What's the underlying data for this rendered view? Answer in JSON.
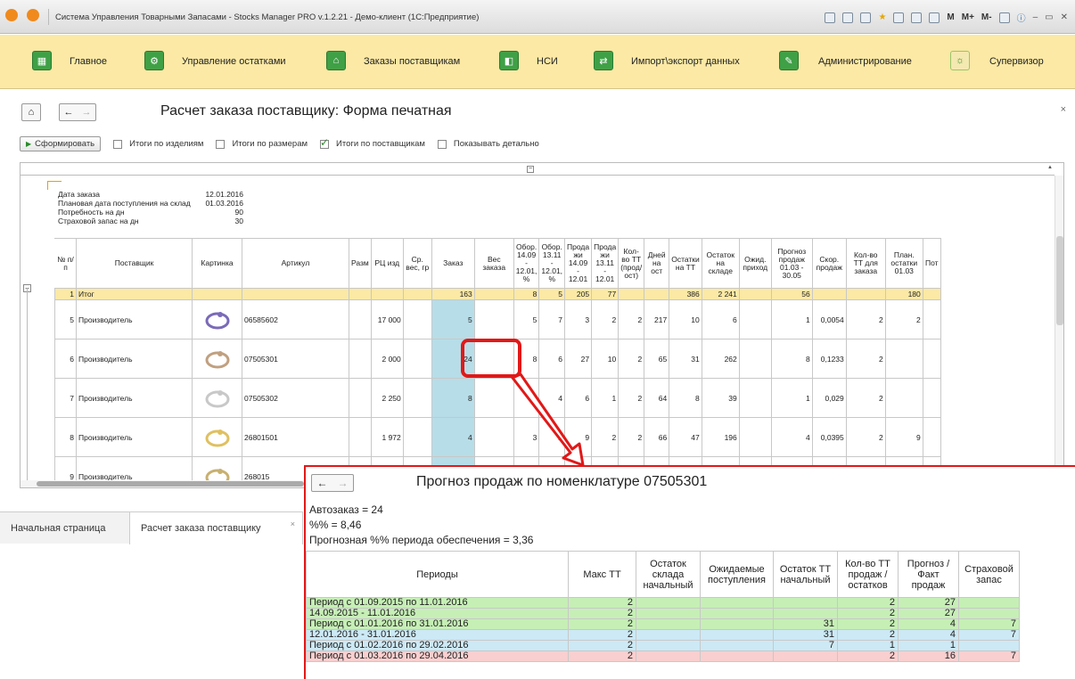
{
  "window": {
    "title": "Система Управления Товарными Запасами - Stocks Manager PRO v.1.2.21 - Демо-клиент (1С:Предприятие)",
    "tools": [
      "M",
      "M+",
      "M-"
    ]
  },
  "nav": {
    "items": [
      {
        "label": "Главное"
      },
      {
        "label": "Управление остатками"
      },
      {
        "label": "Заказы поставщикам"
      },
      {
        "label": "НСИ"
      },
      {
        "label": "Импорт\\экспорт данных"
      },
      {
        "label": "Администрирование"
      },
      {
        "label": "Супервизор"
      }
    ]
  },
  "page": {
    "title": "Расчет заказа поставщику: Форма печатная",
    "close": "×"
  },
  "toolbar": {
    "form_button": "Сформировать",
    "checks": [
      {
        "label": "Итоги по изделиям",
        "checked": false
      },
      {
        "label": "Итоги по размерам",
        "checked": false
      },
      {
        "label": "Итоги по поставщикам",
        "checked": true
      },
      {
        "label": "Показывать детально",
        "checked": false
      }
    ]
  },
  "report": {
    "info": [
      {
        "k": "Дата заказа",
        "v": "12.01.2016"
      },
      {
        "k": "Плановая дата поступления на склад",
        "v": "01.03.2016"
      },
      {
        "k": "Потребность на дн",
        "v": "90"
      },
      {
        "k": "Страховой запас на дн",
        "v": "30"
      }
    ],
    "headers": [
      "№ п/п",
      "Поставщик",
      "Картинка",
      "Артикул",
      "Разм",
      "РЦ изд",
      "Ср. вес, гр",
      "Заказ",
      "Вес заказа",
      "Обор. 14.09 - 12.01, %",
      "Обор. 13.11 - 12.01, %",
      "Прода жи 14.09 - 12.01",
      "Прода жи 13.11 - 12.01",
      "Кол-во ТТ (прод/ ост)",
      "Дней на ост",
      "Остатки на ТТ",
      "Остаток на складе",
      "Ожид. приход",
      "Прогноз продаж 01.03 - 30.05",
      "Скор. продаж",
      "Кол-во ТТ для заказа",
      "План. остатки 01.03",
      "Пот"
    ],
    "itog": [
      "1",
      "Итог",
      "",
      "",
      "",
      "",
      "",
      "163",
      "",
      "8",
      "5",
      "205",
      "77",
      "",
      "",
      "386",
      "2 241",
      "",
      "56",
      "",
      "",
      "180",
      ""
    ],
    "rows": [
      [
        "5",
        "Производитель",
        "",
        "06585602",
        "",
        "17 000",
        "",
        "5",
        "",
        "5",
        "7",
        "3",
        "2",
        "2",
        "217",
        "10",
        "6",
        "",
        "1",
        "0,0054",
        "2",
        "2",
        ""
      ],
      [
        "6",
        "Производитель",
        "",
        "07505301",
        "",
        "2 000",
        "",
        "24",
        "",
        "8",
        "6",
        "27",
        "10",
        "2",
        "65",
        "31",
        "262",
        "",
        "8",
        "0,1233",
        "2",
        "",
        ""
      ],
      [
        "7",
        "Производитель",
        "",
        "07505302",
        "",
        "2 250",
        "",
        "8",
        "",
        "12",
        "4",
        "6",
        "1",
        "2",
        "64",
        "8",
        "39",
        "",
        "1",
        "0,029",
        "2",
        "",
        ""
      ],
      [
        "8",
        "Производитель",
        "",
        "26801501",
        "",
        "1 972",
        "",
        "4",
        "",
        "3",
        "2",
        "9",
        "2",
        "2",
        "66",
        "47",
        "196",
        "",
        "4",
        "0,0395",
        "2",
        "9",
        ""
      ],
      [
        "9",
        "Производитель",
        "",
        "268015",
        "",
        "",
        "",
        "",
        "",
        "",
        "",
        "",
        "",
        "",
        "",
        "",
        "",
        "",
        "",
        "",
        "",
        "",
        ""
      ]
    ]
  },
  "tabs": [
    {
      "label": "Начальная страница"
    },
    {
      "label": "Расчет заказа поставщику"
    }
  ],
  "popup": {
    "title": "Прогноз продаж по номенклатуре 07505301",
    "info": [
      "Автозаказ = 24",
      "%% = 8,46",
      "Прогнозная %% периода обеспечения = 3,36"
    ],
    "headers": [
      "Периоды",
      "Макс ТТ",
      "Остаток склада начальный",
      "Ожидаемые поступления",
      "Остаток ТТ начальный",
      "Кол-во ТТ продаж / остатков",
      "Прогноз / Факт продаж",
      "Страховой запас"
    ],
    "rows": [
      {
        "cls": "g",
        "cells": [
          "Период с 01.09.2015 по 11.01.2016",
          "2",
          "",
          "",
          "",
          "2",
          "27",
          ""
        ]
      },
      {
        "cls": "g",
        "cells": [
          " 14.09.2015 - 11.01.2016",
          "2",
          "",
          "",
          "",
          "2",
          "27",
          ""
        ]
      },
      {
        "cls": "g",
        "cells": [
          "Период с 01.01.2016 по 31.01.2016",
          "2",
          "",
          "",
          "31",
          "2",
          "4",
          "7"
        ]
      },
      {
        "cls": "b",
        "cells": [
          " 12.01.2016 - 31.01.2016",
          "2",
          "",
          "",
          "31",
          "2",
          "4",
          "7"
        ]
      },
      {
        "cls": "b",
        "cells": [
          "Период с 01.02.2016 по 29.02.2016",
          "2",
          "",
          "",
          "7",
          "1",
          "1",
          ""
        ]
      },
      {
        "cls": "p",
        "cells": [
          "Период с 01.03.2016 по 29.04.2016",
          "2",
          "",
          "",
          "",
          "2",
          "16",
          "7"
        ]
      }
    ]
  }
}
